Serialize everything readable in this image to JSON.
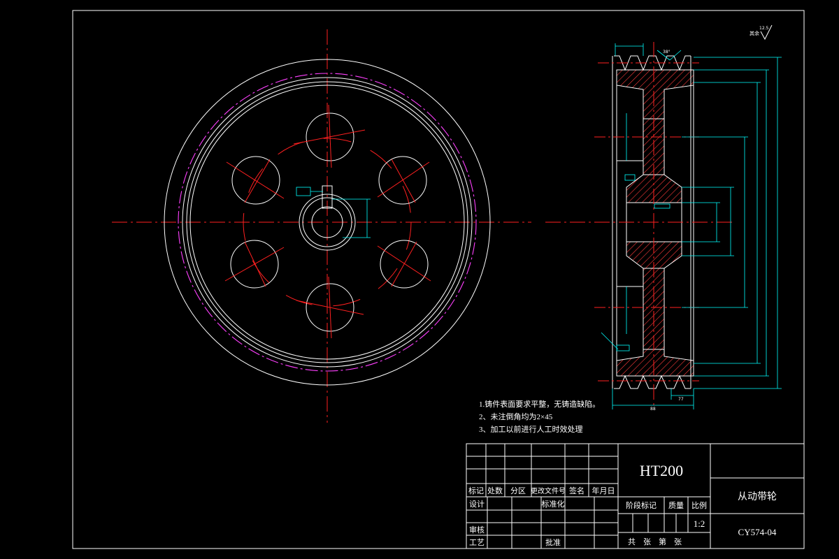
{
  "drawing": {
    "roughness_symbol": "其余",
    "roughness_value": "12.5",
    "notes": [
      "1.铸件表面要求平整，无铸造缺陷。",
      "2、未注倒角均为2×45",
      "3、加工以前进行人工时效处理"
    ],
    "side_view_labels": {
      "tooth_angle": "38°",
      "bottom_dims": [
        "77",
        "88"
      ]
    }
  },
  "title_block": {
    "material": "HT200",
    "part_name": "从动带轮",
    "drawing_number": "CY574-04",
    "scale_header": "比例",
    "scale_value": "1:2",
    "stage_mark_header": "阶段标记",
    "mass_header": "质量",
    "sheets_text": "共    张    第    张",
    "revision_headers": [
      "标记",
      "处数",
      "分区",
      "更改文件号",
      "签名",
      "年月日"
    ],
    "role_design": "设计",
    "role_standardize": "标准化",
    "role_review": "审核",
    "role_process": "工艺",
    "role_approve": "批准"
  },
  "colors": {
    "background": "#000000",
    "outline": "#ffffff",
    "centerline": "#ff2020",
    "hatch": "#ff3b3b",
    "magenta": "#ff40ff",
    "dimension": "#00ffff"
  }
}
